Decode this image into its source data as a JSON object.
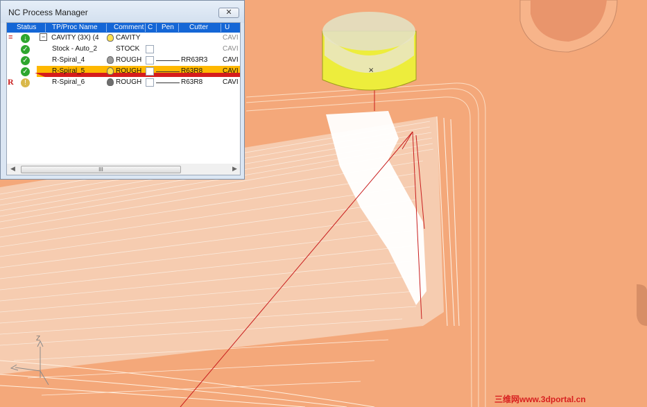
{
  "window": {
    "title": "NC Process Manager",
    "close_glyph": "✕"
  },
  "columns": [
    "Status",
    "TP/Proc Name",
    "Comment",
    "C",
    "Pen",
    "Cutter",
    "U"
  ],
  "rows": [
    {
      "name": "CAVITY (3X) (4",
      "comment": "CAVITY",
      "pen": "",
      "cutter": "",
      "u": "CAVI",
      "expand": "−"
    },
    {
      "name": "Stock - Auto_2",
      "comment": "STOCK",
      "pen": "",
      "cutter": "",
      "u": "CAVI"
    },
    {
      "name": "R-Spiral_4",
      "comment": "ROUGH",
      "pen": "",
      "cutter": "RR63R3",
      "u": "CAVI"
    },
    {
      "name": "R-Spiral_5",
      "comment": "ROUGH",
      "pen": "",
      "cutter": "R63R8",
      "u": "CAVI"
    },
    {
      "name": "R-Spiral_6",
      "comment": "ROUGH",
      "pen": "",
      "cutter": "R63R8",
      "u": "CAVI"
    }
  ],
  "row_markers": {
    "r6": "R"
  },
  "scrollbar": {
    "grip": "III",
    "left": "◀",
    "right": "▶"
  },
  "triad": {
    "z_label": "Z"
  },
  "watermark": "三维网www.3dportal.cn",
  "colors": {
    "part_surface": "#f4a87a",
    "toolpath": "#c81e1e",
    "tool_holder": "#e8e84a",
    "selection": "#ffb800",
    "header": "#1466d6"
  }
}
